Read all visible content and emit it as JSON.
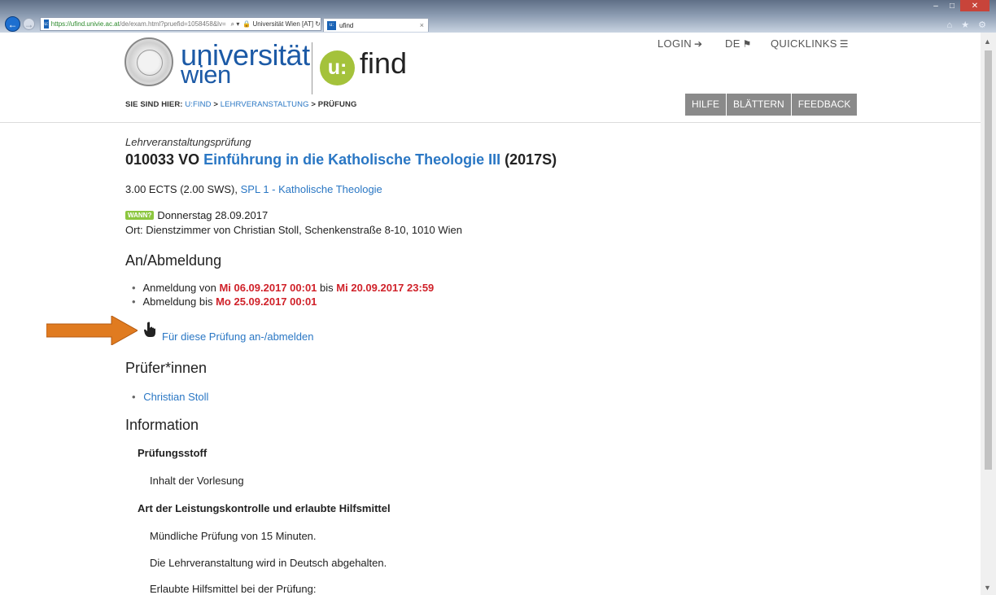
{
  "browser": {
    "url_host": "https://ufind.univie.ac.at",
    "url_path": "/de/exam.html?pruefid=1058458&lv=",
    "address_controls": "⌕ ▾",
    "site_identity": "🔒 Universität Wien [AT] ↻",
    "tab_title": "ufind",
    "tab_favicon": "u:",
    "tab_close": "×",
    "back": "←",
    "forward": "→",
    "window_buttons": [
      "–",
      "□",
      "✕"
    ],
    "tool_icons": "⌂ ★ ⚙"
  },
  "header": {
    "logo_line1": "universität",
    "logo_line2": "wien",
    "ufind_badge": "u:",
    "ufind_word": "find",
    "login_label": "LOGIN",
    "login_icon": "➔",
    "lang_label": "DE",
    "lang_icon": "⚑",
    "quicklinks_label": "QUICKLINKS",
    "quicklinks_icon": "☰",
    "breadcrumb_prefix": "SIE SIND HIER:",
    "breadcrumb_1": "U:FIND",
    "breadcrumb_sep1": ">",
    "breadcrumb_2": "LEHRVERANSTALTUNG",
    "breadcrumb_sep2": ">",
    "breadcrumb_3": "PRÜFUNG",
    "buttons": [
      "HILFE",
      "BLÄTTERN",
      "FEEDBACK"
    ]
  },
  "exam": {
    "type_label": "Lehrveranstaltungsprüfung",
    "course_code": "010033 VO",
    "course_name": "Einführung in die Katholische Theologie III",
    "semester": "(2017S)",
    "ects": "3.00 ECTS (2.00 SWS),",
    "program_link": "SPL 1 - Katholische Theologie",
    "wann_badge": "WANN?",
    "date": "Donnerstag 28.09.2017",
    "location": "Ort: Dienstzimmer von Christian Stoll, Schenkenstraße 8-10, 1010 Wien"
  },
  "registration": {
    "heading": "An/Abmeldung",
    "anmeldung_prefix": "Anmeldung von",
    "anmeldung_from": "Mi 06.09.2017 00:01",
    "anmeldung_mid": "bis",
    "anmeldung_to": "Mi 20.09.2017 23:59",
    "abmeldung_prefix": "Abmeldung bis",
    "abmeldung_to": "Mo 25.09.2017 00:01",
    "register_link": "Für diese Prüfung an-/abmelden"
  },
  "examiners": {
    "heading": "Prüfer*innen",
    "names": [
      "Christian Stoll"
    ]
  },
  "information": {
    "heading": "Information",
    "pruefungsstoff_heading": "Prüfungsstoff",
    "pruefungsstoff_text": "Inhalt der Vorlesung",
    "art_heading": "Art der Leistungskontrolle und erlaubte Hilfsmittel",
    "art_text1": "Mündliche Prüfung von 15 Minuten.",
    "art_text2": "Die Lehrveranstaltung wird in Deutsch abgehalten.",
    "art_text3": "Erlaubte Hilfsmittel bei der Prüfung:"
  },
  "colors": {
    "link": "#2a77c4",
    "deadline_red": "#d0222a",
    "ufind_green": "#a4c23b",
    "wann_green": "#8cc63f",
    "annotation_arrow": "#e07b20",
    "button_gray": "#8a8a8a"
  },
  "icons": {
    "hand": "pointing-hand-icon",
    "annotation": "orange-arrow-icon"
  }
}
